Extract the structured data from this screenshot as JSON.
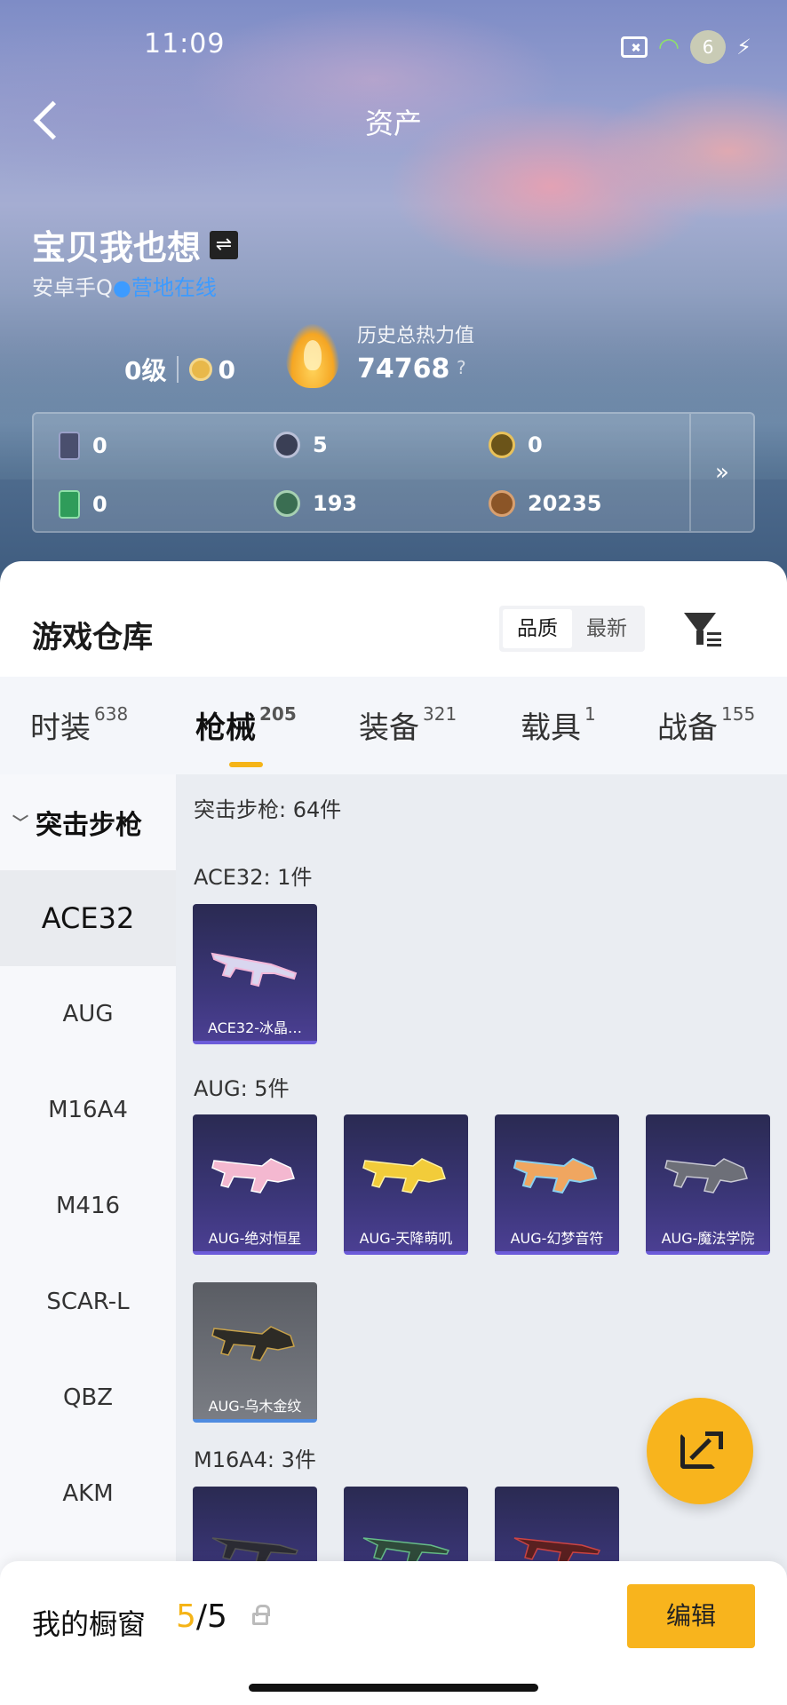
{
  "status_bar": {
    "time": "11:09",
    "battery": "6"
  },
  "nav": {
    "title": "资产"
  },
  "profile": {
    "name": "宝贝我也想",
    "platform": "安卓手Q",
    "online_status": "营地在线",
    "level": "0级",
    "medal_count": "0",
    "heat_label": "历史总热力值",
    "heat_value": "74768",
    "heat_help": "?"
  },
  "stats": [
    {
      "icon": "card-icon",
      "value": "0"
    },
    {
      "icon": "silver-coin-icon",
      "value": "5"
    },
    {
      "icon": "gold-coin-icon",
      "value": "0"
    },
    {
      "icon": "green-card-icon",
      "value": "0"
    },
    {
      "icon": "green-coin-icon",
      "value": "193"
    },
    {
      "icon": "copper-coin-icon",
      "value": "20235"
    }
  ],
  "stats_more": "»",
  "warehouse": {
    "title": "游戏仓库",
    "sort_options": [
      "品质",
      "最新"
    ],
    "sort_active": "品质"
  },
  "categories": [
    {
      "label": "时装",
      "count": "638"
    },
    {
      "label": "枪械",
      "count": "205"
    },
    {
      "label": "装备",
      "count": "321"
    },
    {
      "label": "载具",
      "count": "1"
    },
    {
      "label": "战备",
      "count": "155"
    }
  ],
  "sidebar": {
    "group": "突击步枪",
    "items": [
      "ACE32",
      "AUG",
      "M16A4",
      "M416",
      "SCAR-L",
      "QBZ",
      "AKM"
    ],
    "active": "ACE32"
  },
  "content": {
    "summary": "突击步枪: 64件",
    "sections": [
      {
        "label": "ACE32: 1件",
        "items": [
          "ACE32-冰晶…"
        ]
      },
      {
        "label": "AUG: 5件",
        "items": [
          "AUG-绝对恒星",
          "AUG-天降萌叽",
          "AUG-幻梦音符",
          "AUG-魔法学院",
          "AUG-乌木金纹"
        ]
      },
      {
        "label": "M16A4: 3件",
        "items": [
          "",
          "",
          ""
        ]
      }
    ]
  },
  "showcase": {
    "label": "我的橱窗",
    "current": "5",
    "total": "/5"
  },
  "edit_label": "编辑",
  "colors": {
    "accent": "#f8b41d",
    "link": "#3d9bff",
    "item_purple": "#3b3678"
  }
}
